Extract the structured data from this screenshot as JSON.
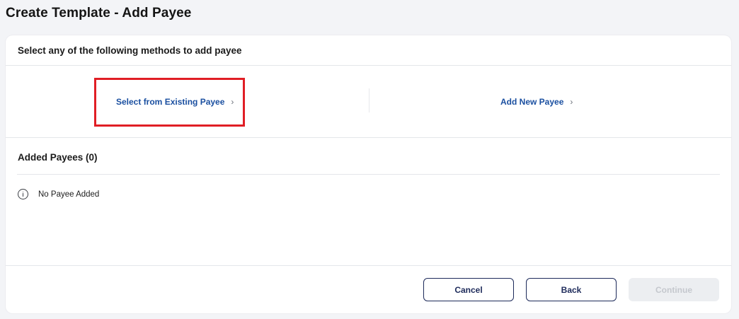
{
  "page": {
    "title": "Create Template - Add Payee"
  },
  "methods": {
    "heading": "Select any of the following methods to add payee",
    "existing_label": "Select from Existing Payee",
    "new_label": "Add New Payee",
    "chevron": "›"
  },
  "added": {
    "heading": "Added Payees (0)",
    "empty_message": "No Payee Added",
    "icon": "info-icon"
  },
  "footer": {
    "cancel_label": "Cancel",
    "back_label": "Back",
    "continue_label": "Continue",
    "continue_disabled": true
  },
  "colors": {
    "link": "#1a4fa0",
    "highlight": "#e01e25",
    "button_outline": "#1d2a5a",
    "disabled_bg": "#eceef1"
  }
}
